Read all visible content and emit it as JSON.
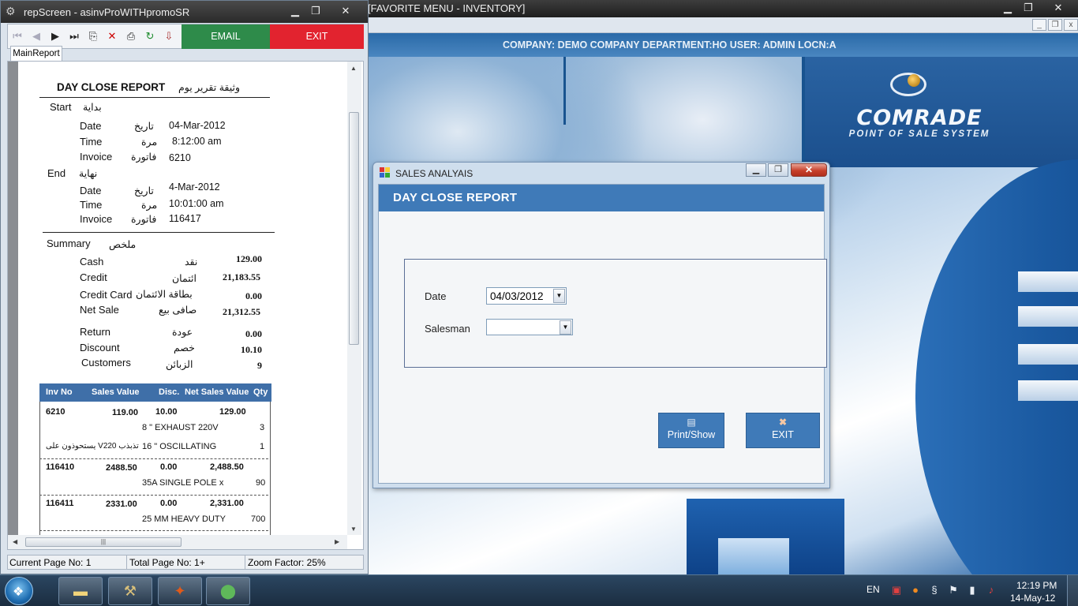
{
  "main_window": {
    "title": "[FAVORITE MENU - INVENTORY]",
    "info_line": "COMPANY: DEMO COMPANY    DEPARTMENT:HO   USER: ADMIN LOCN:A",
    "logo_title": "COMRADE",
    "logo_subtitle": "POINT OF SALE SYSTEM",
    "min_glyph": "▁",
    "max_glyph": "❐",
    "close_glyph": "✕"
  },
  "dialog": {
    "title": "SALES ANALYAIS",
    "header": "DAY CLOSE REPORT",
    "date_label": "Date",
    "date_value": "04/03/2012",
    "salesman_label": "Salesman",
    "salesman_value": "",
    "print_label": "Print/Show",
    "exit_label": "EXIT",
    "close_glyph": "✕"
  },
  "rep_window": {
    "title": "repScreen - asinvProWITHpromoSR",
    "email_label": "EMAIL",
    "exit_label": "EXIT",
    "tab_label": "MainReport",
    "status": {
      "current_page": "Current Page No: 1",
      "total_page": "Total Page No: 1+",
      "zoom": "Zoom Factor: 25%"
    }
  },
  "report": {
    "title_en": "DAY CLOSE REPORT",
    "title_ar": "وثيقة تقرير يوم",
    "start_en": "Start",
    "start_ar": "بداية",
    "end_en": "End",
    "end_ar": "نهاية",
    "date_en": "Date",
    "date_ar": "تاريخ",
    "time_en": "Time",
    "time_ar": "مرة",
    "invoice_en": "Invoice",
    "invoice_ar": "فاتورة",
    "start_date": "04-Mar-2012",
    "start_time": "8:12:00 am",
    "start_invoice": "6210",
    "end_date": "4-Mar-2012",
    "end_time": "10:01:00 am",
    "end_invoice": "116417",
    "summary_en": "Summary",
    "summary_ar": "ملخص",
    "cash_en": "Cash",
    "cash_ar": "نقد",
    "cash_val": "129.00",
    "credit_en": "Credit",
    "credit_ar": "ائتمان",
    "credit_val": "21,183.55",
    "card_en": "Credit Card",
    "card_ar": "بطاقة الائتمان",
    "card_val": "0.00",
    "net_en": "Net Sale",
    "net_ar": "صافى بيع",
    "net_val": "21,312.55",
    "return_en": "Return",
    "return_ar": "عودة",
    "return_val": "0.00",
    "discount_en": "Discount",
    "discount_ar": "خصم",
    "discount_val": "10.10",
    "customers_en": "Customers",
    "customers_ar": "الزبائن",
    "customers_val": "9",
    "grid_headers": [
      "Inv No",
      "Sales Value",
      "Disc.",
      "Net Sales Value",
      "Qty"
    ],
    "rows": [
      {
        "inv": "6210",
        "sales": "119.00",
        "disc": "10.00",
        "net": "129.00"
      },
      {
        "inv": "116410",
        "sales": "2488.50",
        "disc": "0.00",
        "net": "2,488.50"
      },
      {
        "inv": "116411",
        "sales": "2331.00",
        "disc": "0.00",
        "net": "2,331.00"
      }
    ],
    "items": [
      {
        "desc": "8 \" EXHAUST 220V",
        "qty": "3"
      },
      {
        "desc_ar": "يستحوذون على Vتذبذب 220",
        "desc": "16 \" OSCILLATING",
        "qty": "1"
      },
      {
        "desc": "35A SINGLE POLE x",
        "qty": "90"
      },
      {
        "desc": "25 MM HEAVY DUTY",
        "qty": "700"
      }
    ]
  },
  "taskbar": {
    "lang": "EN",
    "time": "12:19 PM",
    "date": "14-May-12"
  }
}
